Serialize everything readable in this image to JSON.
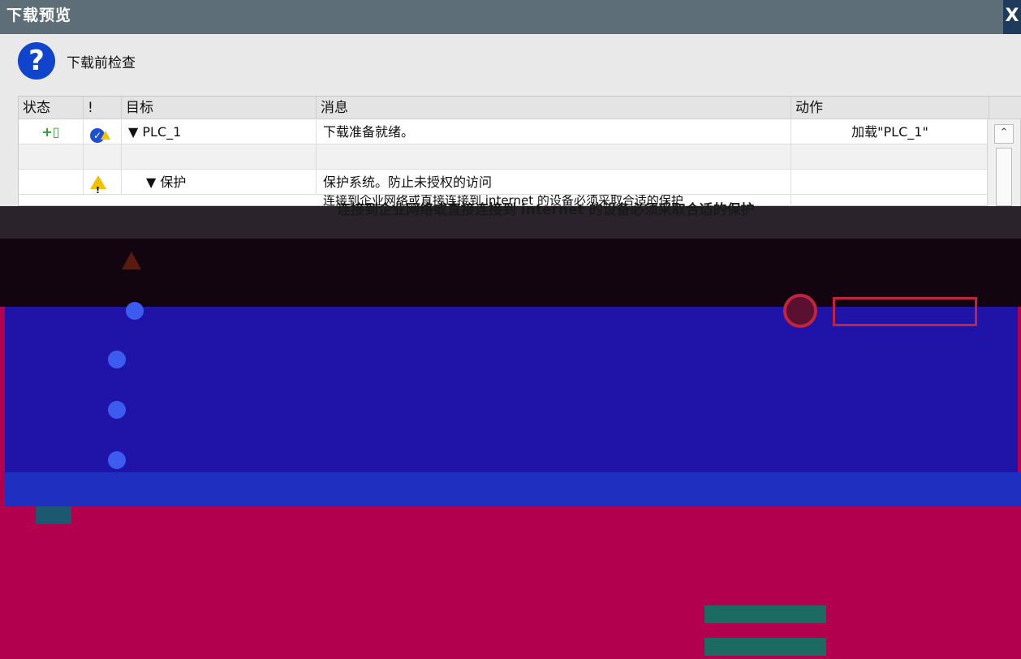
{
  "window": {
    "title": "下载预览",
    "close_symbol": "X"
  },
  "header": {
    "label": "下载前检查",
    "icon_symbol": "?"
  },
  "table": {
    "columns": [
      "状态",
      "!",
      "目标",
      "消息",
      "动作"
    ],
    "rows": [
      {
        "status_icon": "+▯",
        "flag_icon": "shield-warning-icon",
        "target": "▼  PLC_1",
        "message": "下载准备就绪。",
        "action": "加载\"PLC_1\""
      },
      {
        "status_icon": "",
        "flag_icon": "",
        "target": "",
        "message": "",
        "action": ""
      },
      {
        "status_icon": "",
        "flag_icon": "warning-icon",
        "target": "▼  保护",
        "message": "保护系统。防止未授权的访问",
        "action": ""
      },
      {
        "status_icon": "",
        "flag_icon": "",
        "target": "",
        "message": "连接到企业网络或直接连接到 internet 的设备必须采取合适的保护",
        "action": ""
      }
    ],
    "scroll_up_symbol": "⌃"
  },
  "overlay": {
    "text": "连接到企业网络或直接连接到 internet 的设备必须采取合适的保护"
  },
  "colors": {
    "title_bar": "#5e6e78",
    "dialog_bg": "#e9e9e9",
    "band_dark": "#120510",
    "band_blue": "#2014a8",
    "band_pink": "#b3004e"
  }
}
